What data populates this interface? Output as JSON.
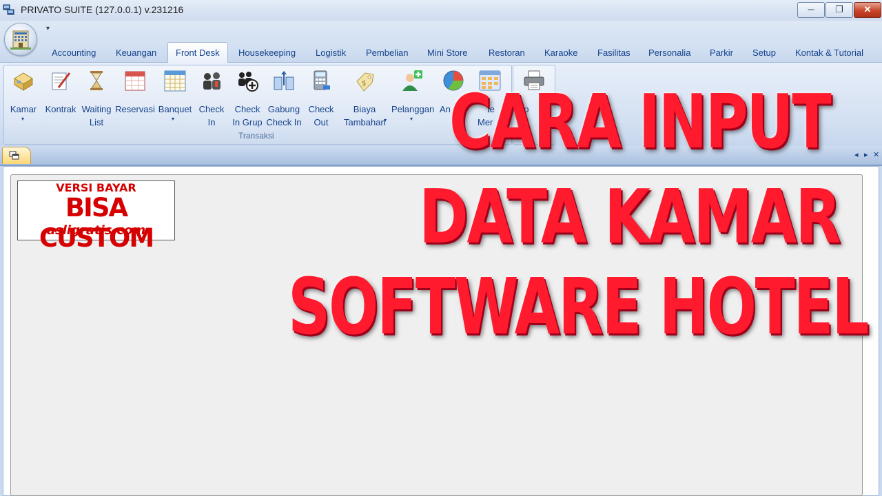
{
  "window": {
    "title": "PRIVATO SUITE (127.0.0.1) v.231216",
    "minimize": "─",
    "restore": "❐",
    "close": "✕"
  },
  "qat": {
    "dropdown": "▾"
  },
  "tabs": [
    "Accounting",
    "Keuangan",
    "Front Desk",
    "Housekeeping",
    "Logistik",
    "Pembelian",
    "Mini Store",
    "Restoran",
    "Karaoke",
    "Fasilitas",
    "Personalia",
    "Parkir",
    "Setup",
    "Kontak & Tutorial"
  ],
  "active_tab": "Front Desk",
  "ribbon": {
    "buttons": [
      {
        "line1": "Kamar",
        "line2": "",
        "arrow": "▾",
        "icon": "hotel-room-icon"
      },
      {
        "line1": "Kontrak",
        "line2": "",
        "arrow": "",
        "icon": "contract-pen-icon"
      },
      {
        "line1": "Waiting",
        "line2": "List",
        "arrow": "",
        "icon": "hourglass-icon"
      },
      {
        "line1": "Reservasi",
        "line2": "",
        "arrow": "",
        "icon": "calendar-icon"
      },
      {
        "line1": "Banquet",
        "line2": "",
        "arrow": "▾",
        "icon": "calendar-grid-icon"
      },
      {
        "line1": "Check",
        "line2": "In",
        "arrow": "",
        "icon": "people-icon"
      },
      {
        "line1": "Check",
        "line2": "In Grup",
        "arrow": "",
        "icon": "group-add-icon"
      },
      {
        "line1": "Gabung",
        "line2": "Check In",
        "arrow": "",
        "icon": "merge-icon"
      },
      {
        "line1": "Check",
        "line2": "Out",
        "arrow": "",
        "icon": "calculator-icon"
      },
      {
        "line1": "Biaya",
        "line2": "Tambahan",
        "arrow": "▾",
        "icon": "money-tag-icon"
      },
      {
        "line1": "Pelanggan",
        "line2": "",
        "arrow": "▾",
        "icon": "customer-add-icon"
      },
      {
        "line1": "An",
        "line2": "",
        "arrow": "",
        "icon": "pie-chart-icon"
      },
      {
        "line1": "te",
        "line2": "Mer",
        "arrow": "",
        "icon": "table-icon"
      },
      {
        "line1": "ap",
        "line2": "",
        "arrow": "",
        "icon": "printer-icon"
      }
    ],
    "group_transaksi": "Transaksi"
  },
  "doc_controls": {
    "prev": "◂",
    "next": "▸",
    "close": "✕"
  },
  "badge": {
    "line1": "VERSI BAYAR",
    "line2": "BISA CUSTOM",
    "line3": "asligratis.com"
  },
  "overlay": {
    "line1": "CARA INPUT",
    "line2": "DATA KAMAR",
    "line3": "SOFTWARE HOTEL"
  },
  "colors": {
    "ribbon_text": "#15428b",
    "overlay_red": "#ff1a2e",
    "badge_red": "#d60000"
  }
}
